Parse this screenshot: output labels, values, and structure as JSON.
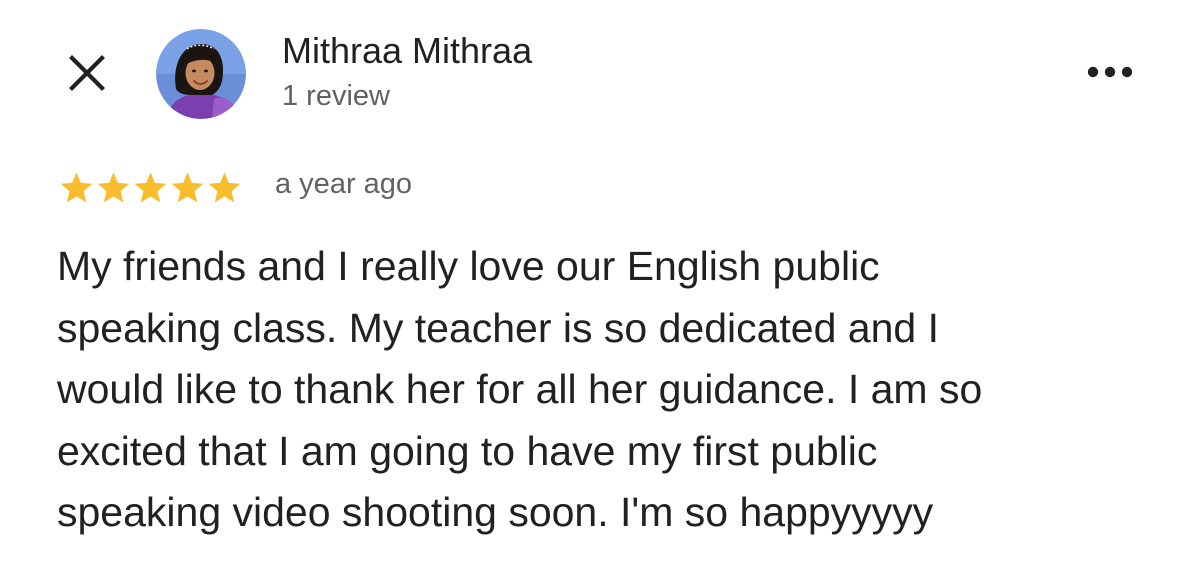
{
  "header": {
    "close_icon": "close-icon",
    "more_icon": "more-horizontal-icon",
    "author_name": "Mithraa Mithraa",
    "review_count": "1 review"
  },
  "review": {
    "rating": 5,
    "rating_max": 5,
    "star_color": "#f9bc2c",
    "time": "a year ago",
    "text_lines": [
      "My friends and I really love our English public",
      "speaking class. My teacher is so dedicated and I",
      "would like to thank her for all her guidance. I am so",
      "excited that I am going to have my first public",
      "speaking video shooting soon. I'm so happyyyyy"
    ]
  }
}
